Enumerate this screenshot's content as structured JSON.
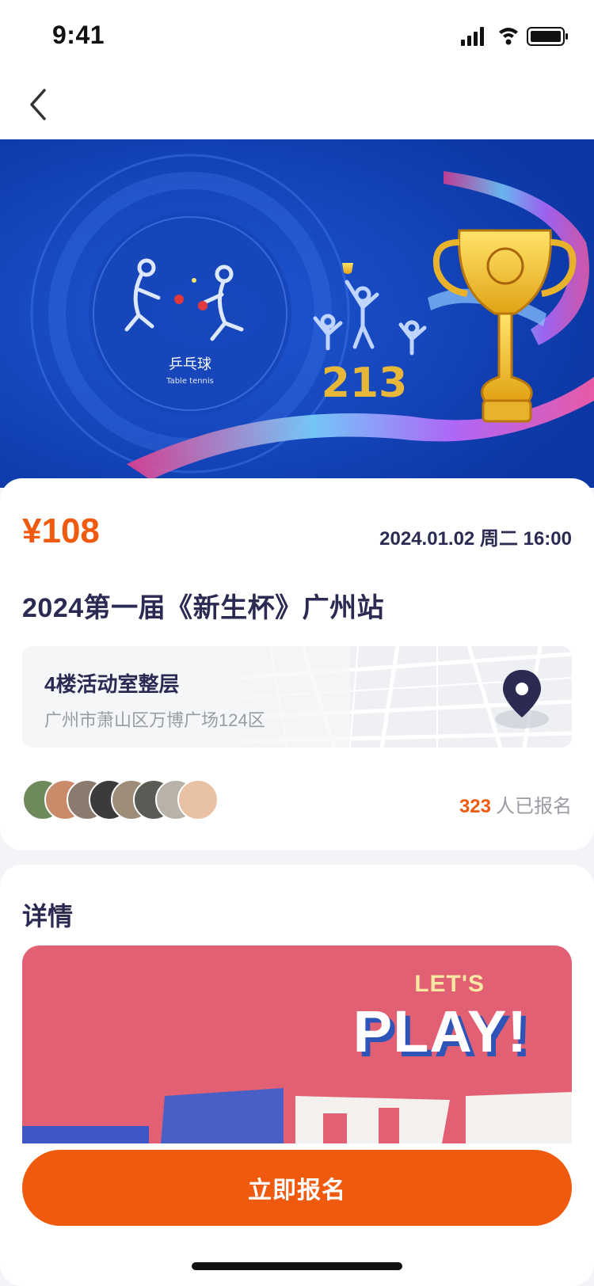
{
  "status_bar": {
    "time": "9:41"
  },
  "banner": {
    "label_cn": "乒乓球",
    "label_en": "Table tennis",
    "podium": "213"
  },
  "event": {
    "price": "¥108",
    "datetime": "2024.01.02 周二 16:00",
    "title": "2024第一届《新生杯》广州站"
  },
  "location": {
    "name": "4楼活动室整层",
    "address": "广州市萧山区万博广场124区"
  },
  "participants": {
    "count": "323",
    "suffix": "人已报名",
    "avatar_colors": [
      "#6F8A5A",
      "#C98B6A",
      "#8B7B6E",
      "#3C3A3A",
      "#9C8C78",
      "#5B5B55",
      "#B8B2A8",
      "#E9C2A5"
    ]
  },
  "detail": {
    "heading": "详情",
    "poster_lets": "LET'S",
    "poster_play": "PLAY!"
  },
  "cta": {
    "label": "立即报名"
  },
  "colors": {
    "accent": "#F05A0F",
    "title": "#2A2A52",
    "banner": "#0E3BAA",
    "poster": "#E26073"
  }
}
